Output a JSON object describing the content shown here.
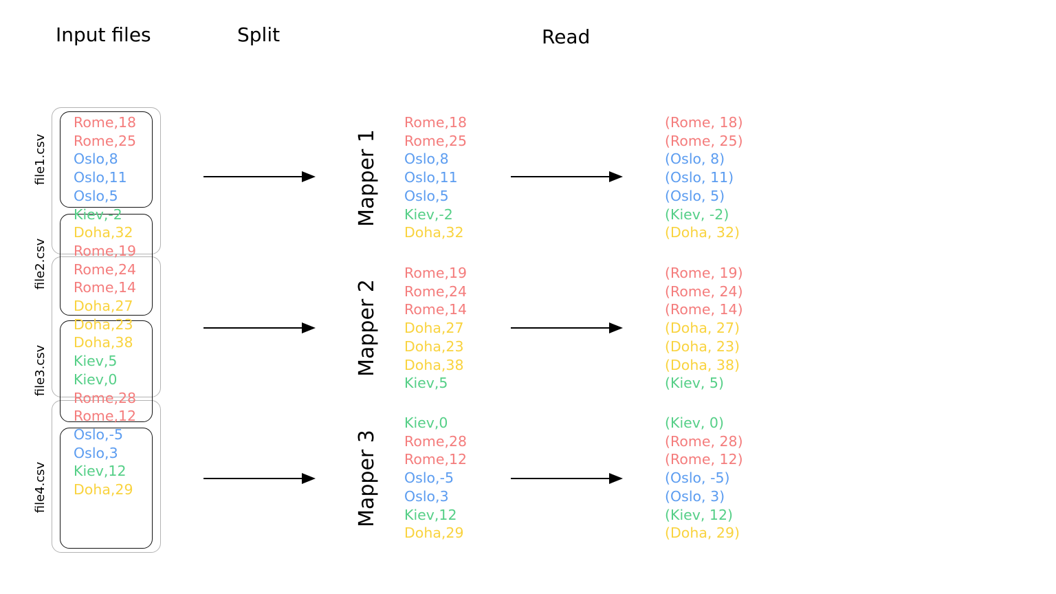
{
  "headers": {
    "input_files": "Input files",
    "split": "Split",
    "read": "Read"
  },
  "colors": {
    "Rome": "#f47c7c",
    "Oslo": "#5b9cf0",
    "Kiev": "#55cf87",
    "Doha": "#f9d33f",
    "file_border": "#b3b3b3",
    "split_border": "#111111"
  },
  "files": [
    {
      "label": "file1.csv"
    },
    {
      "label": "file2.csv"
    },
    {
      "label": "file3.csv"
    },
    {
      "label": "file4.csv"
    }
  ],
  "input_lines": [
    "Rome,18",
    "Rome,25",
    "Oslo,8",
    "Oslo,11",
    "Oslo,5",
    "Kiev,-2",
    "Doha,32",
    "Rome,19",
    "Rome,24",
    "Rome,14",
    "Doha,27",
    "Doha,23",
    "Doha,38",
    "Kiev,5",
    "Kiev,0",
    "Rome,28",
    "Rome,12",
    "Oslo,-5",
    "Oslo,3",
    "Kiev,12",
    "Doha,29"
  ],
  "mappers": [
    {
      "label": "Mapper 1",
      "split_lines": [
        "Rome,18",
        "Rome,25",
        "Oslo,8",
        "Oslo,11",
        "Oslo,5",
        "Kiev,-2",
        "Doha,32"
      ],
      "read_lines": [
        "(Rome, 18)",
        "(Rome, 25)",
        "(Oslo, 8)",
        "(Oslo, 11)",
        "(Oslo, 5)",
        "(Kiev, -2)",
        "(Doha, 32)"
      ]
    },
    {
      "label": "Mapper 2",
      "split_lines": [
        "Rome,19",
        "Rome,24",
        "Rome,14",
        "Doha,27",
        "Doha,23",
        "Doha,38",
        "Kiev,5"
      ],
      "read_lines": [
        "(Rome, 19)",
        "(Rome, 24)",
        "(Rome, 14)",
        "(Doha, 27)",
        "(Doha, 23)",
        "(Doha, 38)",
        "(Kiev, 5)"
      ]
    },
    {
      "label": "Mapper 3",
      "split_lines": [
        "Kiev,0",
        "Rome,28",
        "Rome,12",
        "Oslo,-5",
        "Oslo,3",
        "Kiev,12",
        "Doha,29"
      ],
      "read_lines": [
        "(Kiev, 0)",
        "(Rome, 28)",
        "(Rome, 12)",
        "(Oslo, -5)",
        "(Oslo, 3)",
        "(Kiev, 12)",
        "(Doha, 29)"
      ]
    }
  ]
}
